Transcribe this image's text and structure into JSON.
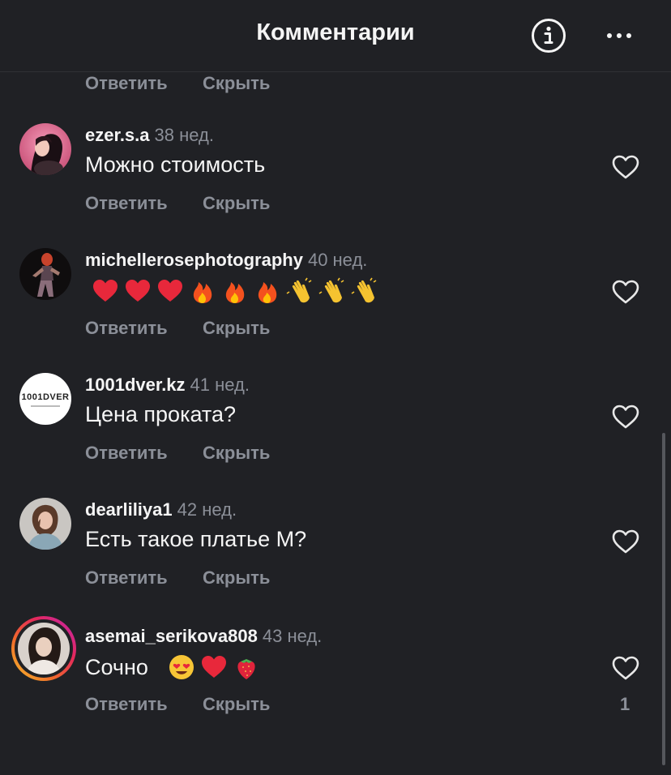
{
  "header": {
    "title": "Комментарии",
    "info_icon": "info-circle-icon",
    "more_icon": "more-horizontal-icon"
  },
  "top_actions": {
    "reply": "Ответить",
    "hide": "Скрыть"
  },
  "comments": [
    {
      "username": "ezer.s.a",
      "time": "38 нед.",
      "text": "Можно стоимость",
      "reply": "Ответить",
      "hide": "Скрыть"
    },
    {
      "username": "michellerosephotography",
      "time": "40 нед.",
      "text": "❤️❤️❤️🔥🔥🔥👏👏👏",
      "reply": "Ответить",
      "hide": "Скрыть"
    },
    {
      "username": "1001dver.kz",
      "time": "41 нед.",
      "text": "Цена проката?",
      "avatar_logo": "1001DVER",
      "reply": "Ответить",
      "hide": "Скрыть"
    },
    {
      "username": "dearliliya1",
      "time": "42 нед.",
      "text": "Есть такое платье М?",
      "reply": "Ответить",
      "hide": "Скрыть"
    },
    {
      "username": "asemai_serikova808",
      "time": "43 нед.",
      "text": "Сочно",
      "text_emojis": "😍❤️🍓",
      "reply": "Ответить",
      "hide": "Скрыть",
      "likes": "1"
    }
  ],
  "colors": {
    "background": "#202125",
    "text_primary": "#f5f5f5",
    "text_secondary": "#8b8f98",
    "story_ring_gradient": [
      "#f6c32d",
      "#e4285c",
      "#c025b3"
    ]
  }
}
